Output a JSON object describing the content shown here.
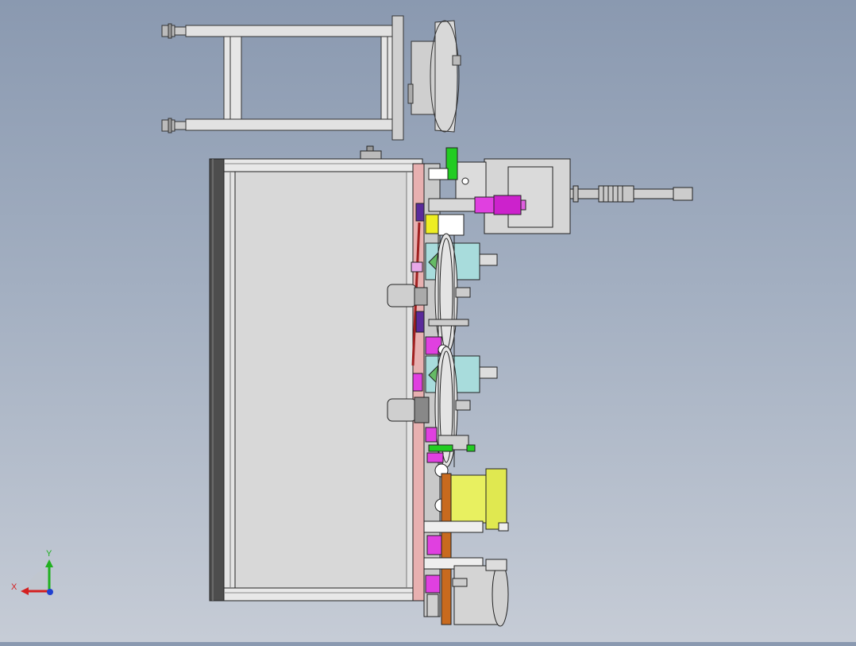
{
  "viewport": {
    "background_top": "#8a99b0",
    "background_bottom": "#c6ccd6"
  },
  "model": {
    "colors": {
      "frame_steel": "#dcdcdc",
      "frame_dark": "#4a4a4a",
      "panel": "#d9d9d9",
      "green_part": "#22cc22",
      "magenta_part": "#e040e0",
      "yellow_part": "#e8f060",
      "cyan_part": "#a8dcdc",
      "orange_part": "#c86a1e",
      "purple_part": "#5a2a9a",
      "red_part": "#c03030"
    }
  },
  "axis_triad": {
    "x_label": "X",
    "y_label": "Y",
    "x_color": "#d42020",
    "y_color": "#20b020",
    "z_color": "#2040d0"
  }
}
